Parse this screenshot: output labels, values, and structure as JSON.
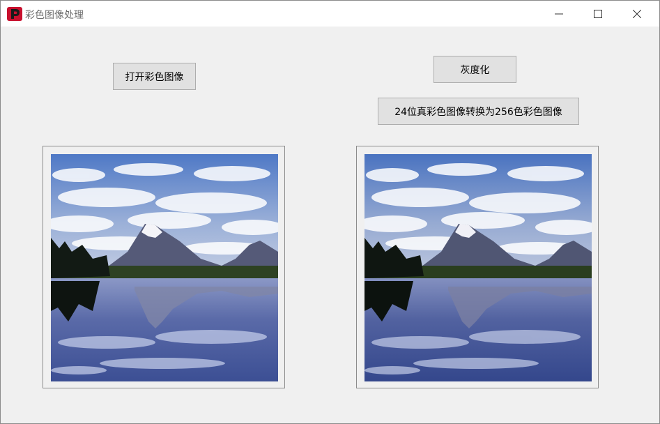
{
  "window": {
    "title": "彩色图像处理",
    "icon": "p-logo-icon",
    "accent": "#c8102e"
  },
  "controls": {
    "minimize": "minimize-icon",
    "maximize": "maximize-icon",
    "close": "close-icon"
  },
  "buttons": {
    "open": "打开彩色图像",
    "grayscale": "灰度化",
    "convert": "24位真彩色图像转换为256色彩色图像"
  },
  "images": {
    "left": {
      "subject": "mountain-lake-reflection-image",
      "mode": "24-bit color"
    },
    "right": {
      "subject": "mountain-lake-reflection-image",
      "mode": "256-color"
    }
  }
}
